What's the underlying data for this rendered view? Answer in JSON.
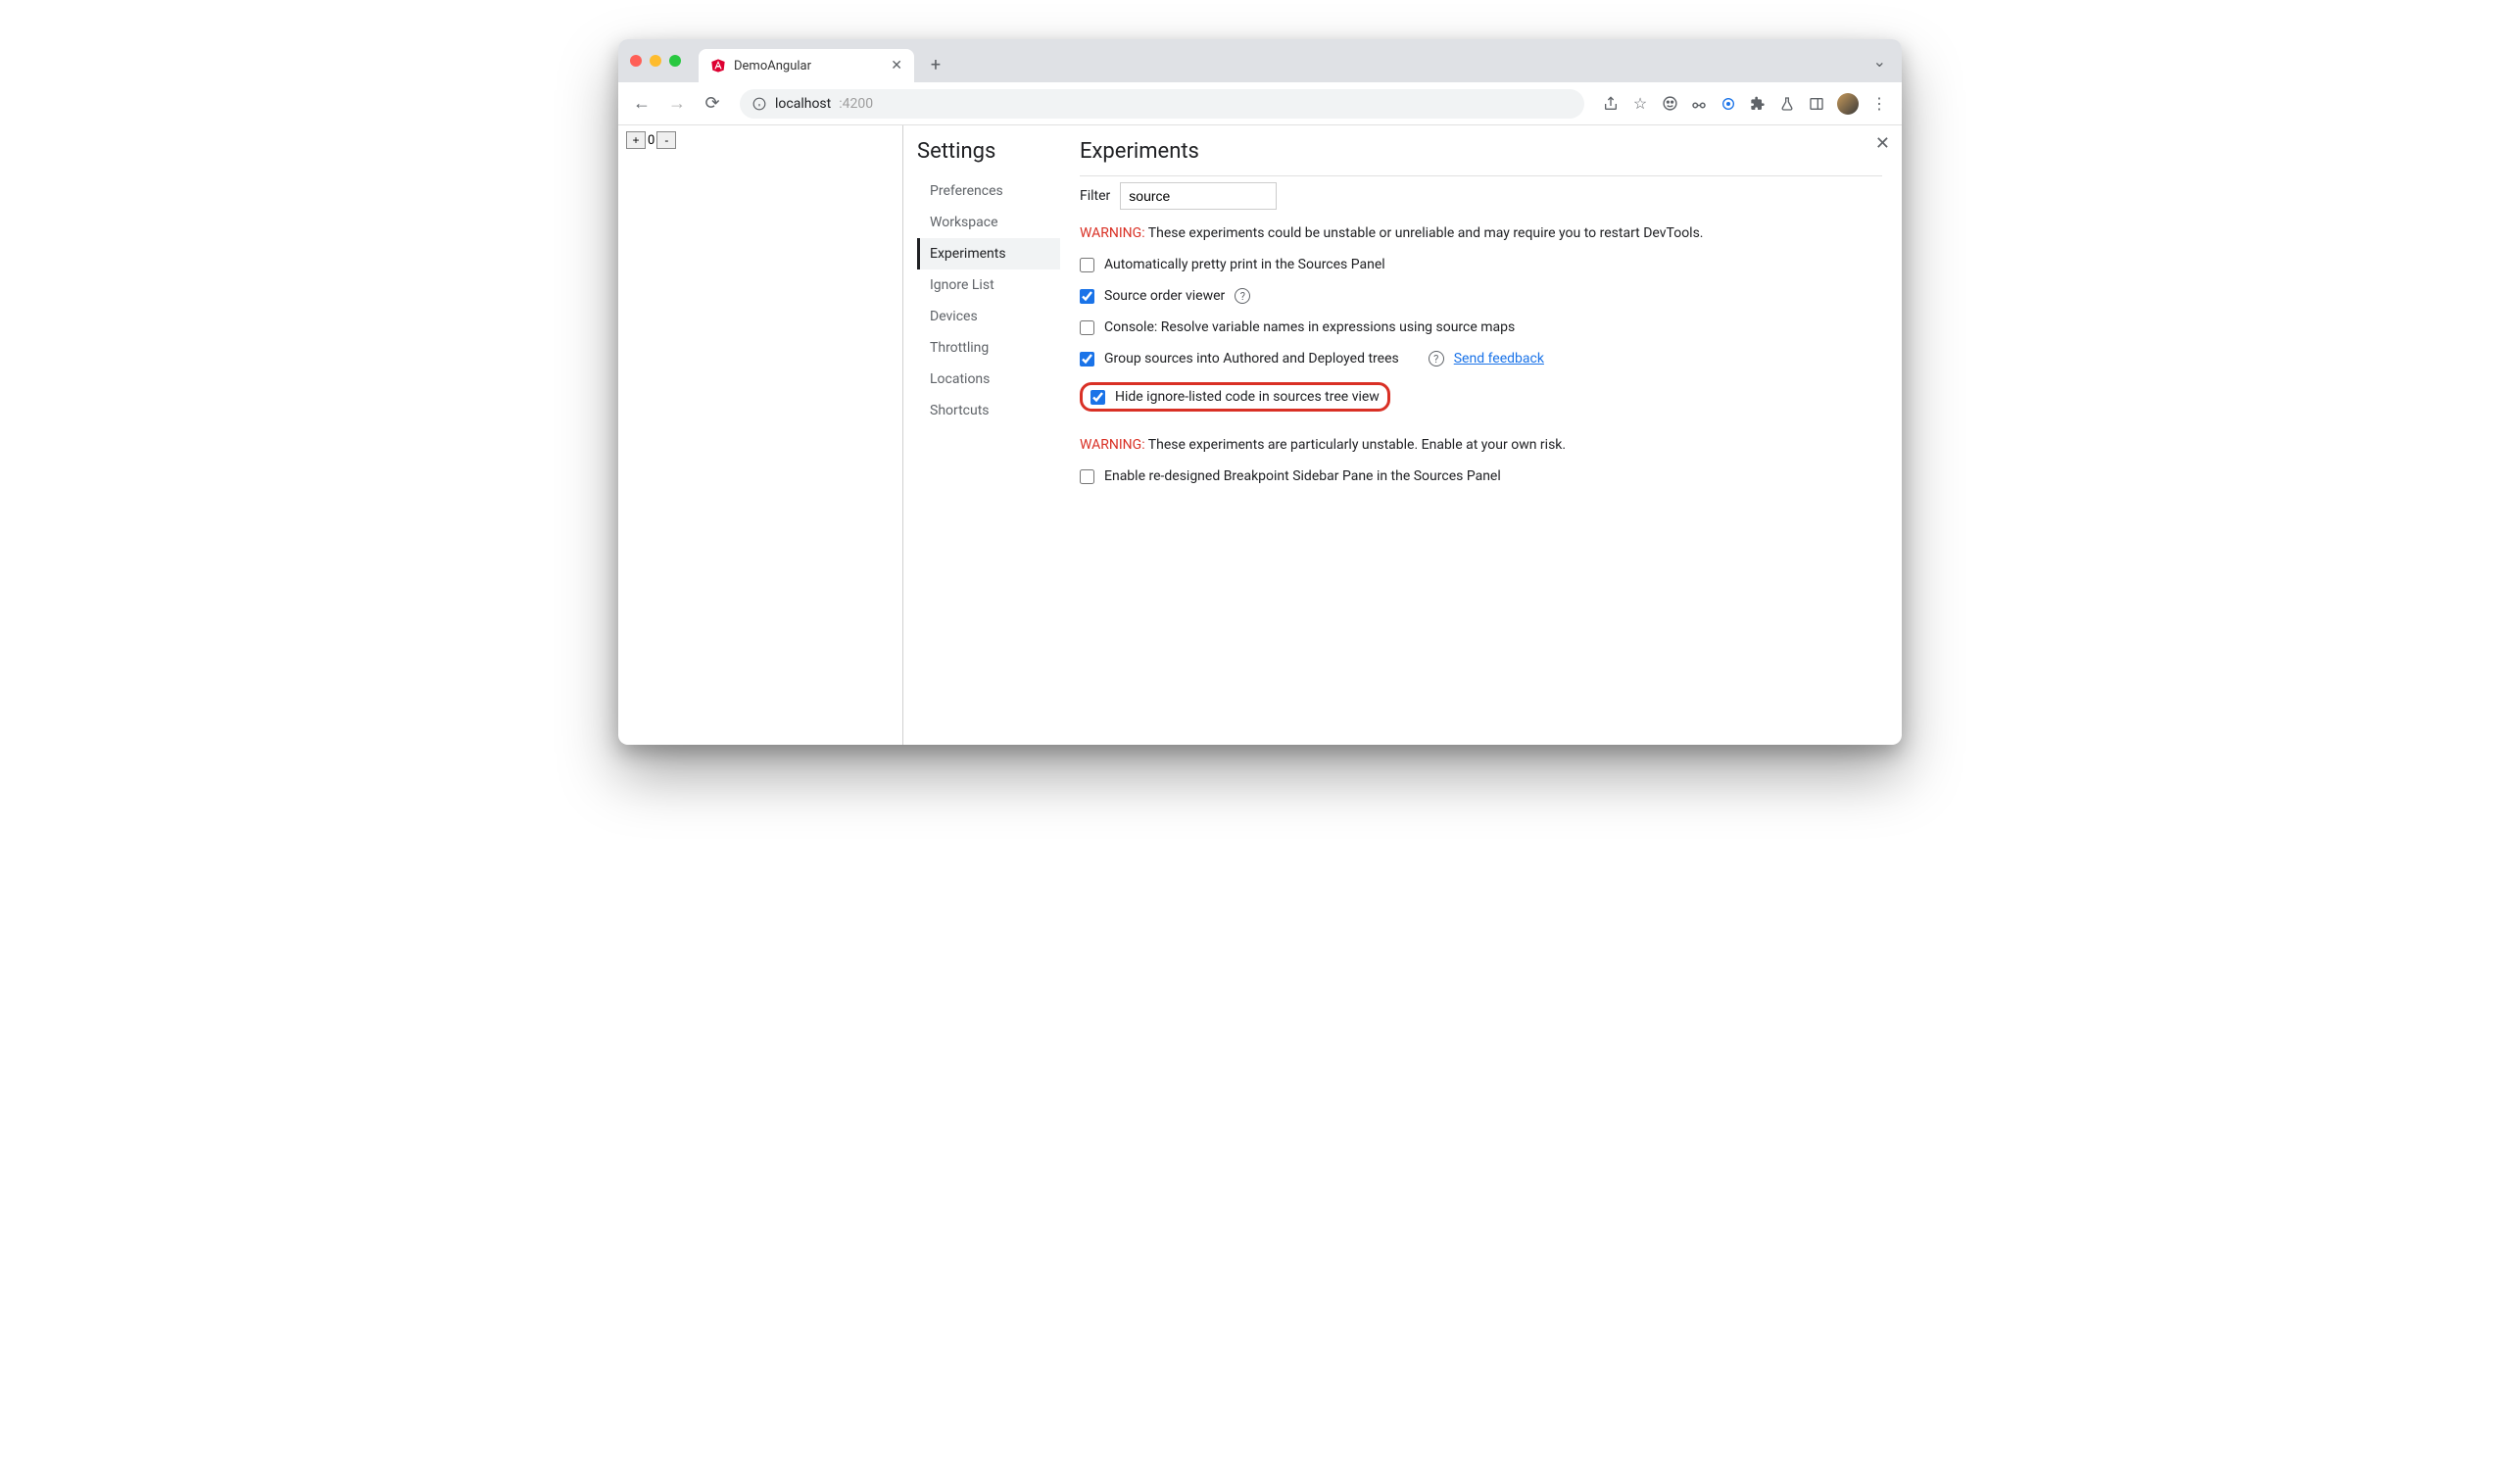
{
  "tab": {
    "title": "DemoAngular"
  },
  "address": {
    "host": "localhost",
    "port": ":4200"
  },
  "page": {
    "counter_value": "0"
  },
  "settings": {
    "title": "Settings",
    "nav": [
      {
        "label": "Preferences"
      },
      {
        "label": "Workspace"
      },
      {
        "label": "Experiments"
      },
      {
        "label": "Ignore List"
      },
      {
        "label": "Devices"
      },
      {
        "label": "Throttling"
      },
      {
        "label": "Locations"
      },
      {
        "label": "Shortcuts"
      }
    ],
    "main": {
      "heading": "Experiments",
      "filter_label": "Filter",
      "filter_value": "source",
      "warning1_prefix": "WARNING:",
      "warning1_text": " These experiments could be unstable or unreliable and may require you to restart DevTools.",
      "experiments": [
        {
          "label": "Automatically pretty print in the Sources Panel",
          "checked": false,
          "help": false,
          "link": null
        },
        {
          "label": "Source order viewer",
          "checked": true,
          "help": true,
          "link": null
        },
        {
          "label": "Console: Resolve variable names in expressions using source maps",
          "checked": false,
          "help": false,
          "link": null
        },
        {
          "label": "Group sources into Authored and Deployed trees",
          "checked": true,
          "help": true,
          "link": "Send feedback"
        },
        {
          "label": "Hide ignore-listed code in sources tree view",
          "checked": true,
          "help": false,
          "link": null,
          "highlighted": true
        }
      ],
      "warning2_prefix": "WARNING:",
      "warning2_text": " These experiments are particularly unstable. Enable at your own risk.",
      "experiments2": [
        {
          "label": "Enable re-designed Breakpoint Sidebar Pane in the Sources Panel",
          "checked": false
        }
      ]
    }
  }
}
